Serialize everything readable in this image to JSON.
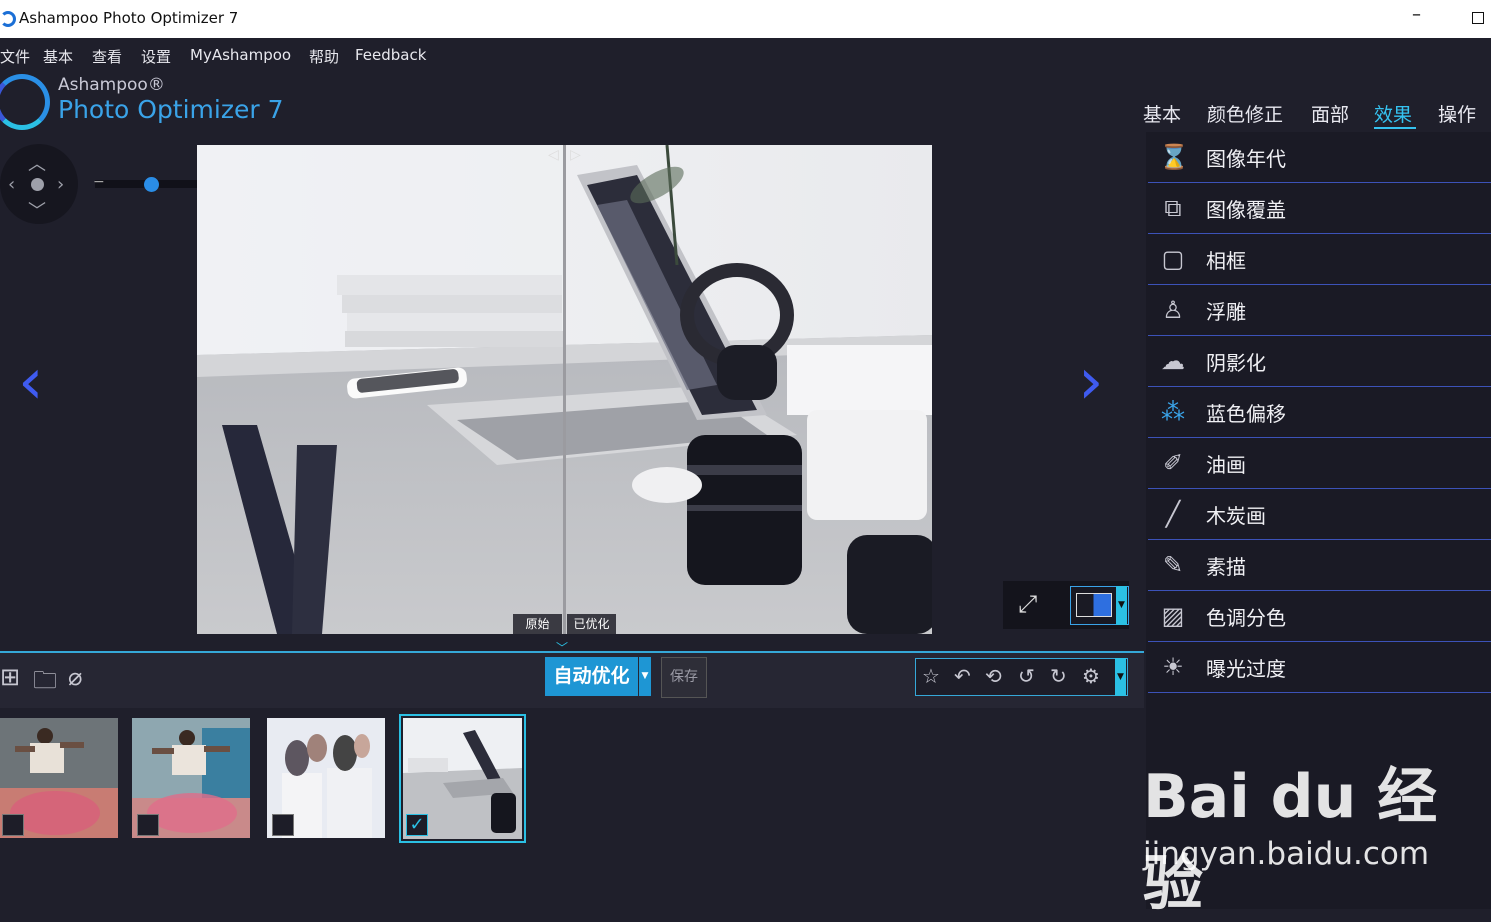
{
  "window": {
    "title": "Ashampoo Photo Optimizer 7"
  },
  "menu": [
    "文件",
    "基本",
    "查看",
    "设置",
    "MyAshampoo",
    "帮助",
    "Feedback"
  ],
  "brand": {
    "small": "Ashampoo®",
    "big": "Photo Optimizer 7"
  },
  "category_tabs": [
    {
      "label": "基本",
      "active": false
    },
    {
      "label": "颜色修正",
      "active": false
    },
    {
      "label": "面部",
      "active": false
    },
    {
      "label": "效果",
      "active": true
    },
    {
      "label": "操作",
      "active": false
    }
  ],
  "compare": {
    "left_label": "原始",
    "right_label": "已优化"
  },
  "toolbar": {
    "auto_label": "自动优化",
    "save_label": "保存"
  },
  "thumbnails": [
    {
      "name": "jump-1",
      "checked": false
    },
    {
      "name": "jump-2",
      "checked": false
    },
    {
      "name": "brushes",
      "checked": false
    },
    {
      "name": "desk-laptop",
      "checked": true
    }
  ],
  "effects": [
    {
      "label": "图像年代",
      "icon": "hourglass-icon"
    },
    {
      "label": "图像覆盖",
      "icon": "image-overlay-icon"
    },
    {
      "label": "相框",
      "icon": "frame-icon"
    },
    {
      "label": "浮雕",
      "icon": "emboss-icon"
    },
    {
      "label": "阴影化",
      "icon": "shadow-icon"
    },
    {
      "label": "蓝色偏移",
      "icon": "blue-shift-icon"
    },
    {
      "label": "油画",
      "icon": "brush-icon"
    },
    {
      "label": "木炭画",
      "icon": "charcoal-icon"
    },
    {
      "label": "素描",
      "icon": "pencil-icon"
    },
    {
      "label": "色调分色",
      "icon": "posterize-icon"
    },
    {
      "label": "曝光过度",
      "icon": "overexposure-icon"
    }
  ],
  "watermark": {
    "line1": "Bai du 经验",
    "line2": "jingyan.baidu.com"
  },
  "colors": {
    "accent": "#2bc0e4",
    "nav_arrow": "#3f5bf0",
    "background": "#1f1f2b"
  }
}
